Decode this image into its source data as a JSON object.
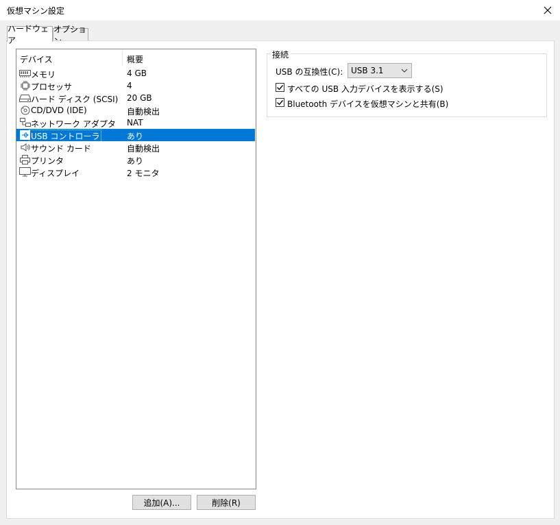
{
  "window": {
    "title": "仮想マシン設定"
  },
  "tabs": [
    {
      "label": "ハードウェア",
      "active": true
    },
    {
      "label": "オプション",
      "active": false
    }
  ],
  "device_list": {
    "columns": {
      "device": "デバイス",
      "summary": "概要"
    },
    "rows": [
      {
        "name": "メモリ",
        "value": "4 GB",
        "icon": "memory-icon"
      },
      {
        "name": "プロセッサ",
        "value": "4",
        "icon": "processor-icon"
      },
      {
        "name": "ハード ディスク (SCSI)",
        "value": "20 GB",
        "icon": "hard-disk-icon"
      },
      {
        "name": "CD/DVD (IDE)",
        "value": "自動検出",
        "icon": "cd-dvd-icon"
      },
      {
        "name": "ネットワーク アダプタ",
        "value": "NAT",
        "icon": "network-adapter-icon"
      },
      {
        "name": "USB コントローラ",
        "value": "あり",
        "icon": "usb-icon",
        "selected": true
      },
      {
        "name": "サウンド カード",
        "value": "自動検出",
        "icon": "sound-card-icon"
      },
      {
        "name": "プリンタ",
        "value": "あり",
        "icon": "printer-icon"
      },
      {
        "name": "ディスプレイ",
        "value": "2 モニタ",
        "icon": "display-icon"
      }
    ]
  },
  "buttons": {
    "add": "追加(A)...",
    "remove": "削除(R)"
  },
  "connection": {
    "title": "接続",
    "compat_label": "USB の互換性(C):",
    "compat_value": "USB 3.1",
    "show_all_usb": {
      "label": "すべての USB 入力デバイスを表示する(S)",
      "checked": true
    },
    "share_bluetooth": {
      "label": "Bluetooth デバイスを仮想マシンと共有(B)",
      "checked": true
    }
  },
  "colors": {
    "selection": "#0078d7",
    "background": "#f0f0f0"
  }
}
